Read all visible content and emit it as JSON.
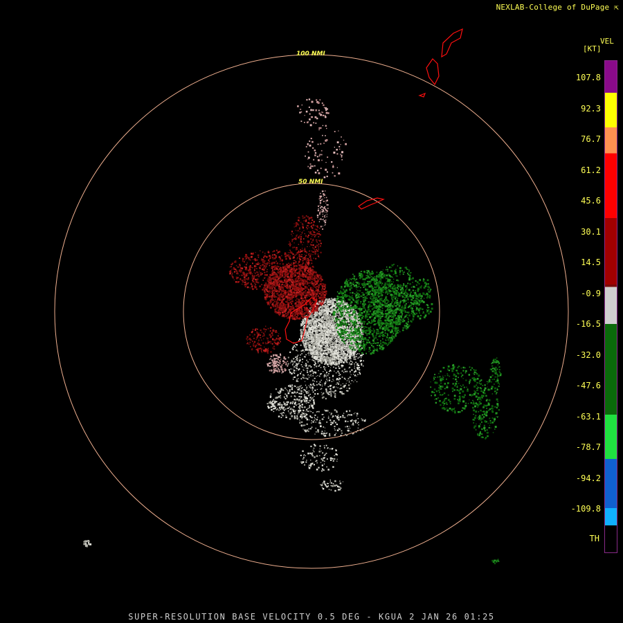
{
  "credit": "NEXLAB-College of DuPage ⇱",
  "legend": {
    "product": "VEL",
    "unit": "[KT]",
    "ticks": [
      "107.8",
      "92.3",
      "76.7",
      "61.2",
      "45.6",
      "30.1",
      "14.5",
      "-0.9",
      "-16.5",
      "-32.0",
      "-47.6",
      "-63.1",
      "-78.7",
      "-94.2",
      "-109.8",
      "TH"
    ],
    "color_stops": [
      {
        "color": "#8a0a8a",
        "from": 0.0,
        "to": 0.065
      },
      {
        "color": "#ffff00",
        "from": 0.065,
        "to": 0.135
      },
      {
        "color": "#ff9050",
        "from": 0.135,
        "to": 0.188
      },
      {
        "color": "#ff0000",
        "from": 0.188,
        "to": 0.32
      },
      {
        "color": "#a00000",
        "from": 0.32,
        "to": 0.455
      },
      {
        "color": "#7a0a0a",
        "from": 0.455,
        "to": 0.46
      },
      {
        "color": "#cfcfcf",
        "from": 0.46,
        "to": 0.535
      },
      {
        "color": "#0a6a0a",
        "from": 0.535,
        "to": 0.72
      },
      {
        "color": "#20e040",
        "from": 0.72,
        "to": 0.81
      },
      {
        "color": "#1060d0",
        "from": 0.81,
        "to": 0.91
      },
      {
        "color": "#10b0ff",
        "from": 0.91,
        "to": 0.945
      },
      {
        "color": "#000000",
        "from": 0.945,
        "to": 1.0
      }
    ]
  },
  "rings": [
    {
      "label": "50 NMI"
    },
    {
      "label": "100 NMI"
    }
  ],
  "footer": "SUPER-RESOLUTION BASE VELOCITY 0.5 DEG - KGUA 2 JAN 26 01:25",
  "colors": {
    "ring": "#f0b090",
    "coast": "#ff1010",
    "inbound_green": "#1a8a1a",
    "outbound_red": "#a01010",
    "near_zero": "#d8d8d0"
  }
}
